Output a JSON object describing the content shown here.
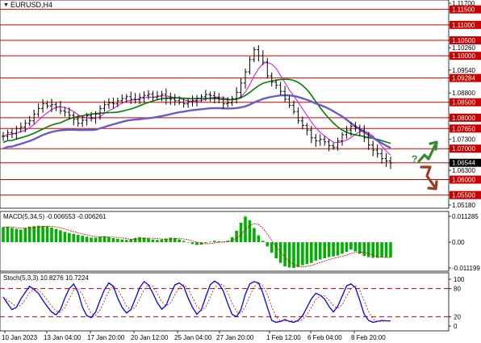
{
  "symbol_title": "EURUSD,H4",
  "colors": {
    "price_line": "#000000",
    "sma_short": "#e800e8",
    "sma_mid": "#008000",
    "sma_long": "#6a5acd",
    "level_line": "#cc0000",
    "macd_hist": "#00b000",
    "macd_signal": "#cc0000",
    "stoch_main": "#0000ff",
    "stoch_signal": "#cc0000",
    "arrow_up": "#2e8b2e",
    "arrow_down": "#a0391e"
  },
  "price_axis": {
    "labels": [
      "1.11700",
      "1.11500",
      "1.11000",
      "1.10500",
      "1.10260",
      "1.10000",
      "1.09540",
      "1.09284",
      "1.08800",
      "1.08500",
      "1.08000",
      "1.07650",
      "1.07300",
      "1.07000",
      "1.06544",
      "1.06300",
      "1.06000",
      "1.05500",
      "1.05180"
    ],
    "highlighted": [
      "1.11500",
      "1.11000",
      "1.10500",
      "1.10000",
      "1.09284",
      "1.08500",
      "1.08000",
      "1.07650",
      "1.07000",
      "1.06544",
      "1.06000",
      "1.05500"
    ],
    "current_price": "1.06544"
  },
  "levels": [
    1.115,
    1.11,
    1.105,
    1.1,
    1.09284,
    1.085,
    1.08,
    1.0765,
    1.07,
    1.06544,
    1.06,
    1.055
  ],
  "macd": {
    "label": "MACD(5,34,5) -0.006553 -0.006261",
    "axis_labels": [
      "0.011285",
      "0.00",
      "-0.011199"
    ]
  },
  "stoch": {
    "label": "Stoch(5,3,3) 10.8276 10.7224",
    "axis_labels": [
      "100",
      "80",
      "20",
      "0"
    ]
  },
  "time_axis": [
    "10 Jan 2023",
    "13 Jan 04:00",
    "17 Jan 20:00",
    "20 Jan 12:00",
    "25 Jan 04:00",
    "27 Jan 20:00",
    "1 Feb 12:00",
    "6 Feb 04:00",
    "8 Feb 20:00"
  ],
  "annotation": {
    "question_mark": "?"
  },
  "chart_data": {
    "type": "line",
    "title": "EURUSD,H4",
    "y_range": [
      1.0518,
      1.117
    ],
    "price_path": [
      1.074,
      1.0752,
      1.0748,
      1.0765,
      1.077,
      1.0782,
      1.079,
      1.0812,
      1.083,
      1.0845,
      1.0838,
      1.0842,
      1.0835,
      1.0822,
      1.0818,
      1.0808,
      1.0795,
      1.0782,
      1.0792,
      1.0806,
      1.08,
      1.0812,
      1.083,
      1.0842,
      1.0848,
      1.0845,
      1.0855,
      1.0862,
      1.0868,
      1.086,
      1.0858,
      1.0866,
      1.0872,
      1.0876,
      1.0866,
      1.087,
      1.0876,
      1.0862,
      1.086,
      1.0855,
      1.085,
      1.0845,
      1.0853,
      1.0856,
      1.0862,
      1.0868,
      1.0875,
      1.0872,
      1.0865,
      1.086,
      1.0845,
      1.0848,
      1.0862,
      1.0882,
      1.0912,
      1.0948,
      1.0988,
      1.102,
      1.1,
      1.098,
      1.0935,
      1.0915,
      1.0905,
      1.0885,
      1.086,
      1.084,
      1.082,
      1.079,
      1.0775,
      1.076,
      1.0735,
      1.0725,
      1.073,
      1.0722,
      1.071,
      1.0705,
      1.0725,
      1.0745,
      1.076,
      1.0772,
      1.0768,
      1.076,
      1.0735,
      1.0712,
      1.0695,
      1.0684,
      1.0668,
      1.066,
      1.0654
    ],
    "macd_hist": [
      0.0065,
      0.0068,
      0.0062,
      0.0058,
      0.0055,
      0.0062,
      0.0068,
      0.007,
      0.0072,
      0.0071,
      0.0069,
      0.0064,
      0.0058,
      0.0052,
      0.0045,
      0.004,
      0.0036,
      0.0032,
      0.0028,
      0.0024,
      0.002,
      0.002,
      0.0024,
      0.0026,
      0.0022,
      0.0018,
      0.0015,
      0.0012,
      0.001,
      0.0013,
      0.0018,
      0.0022,
      0.002,
      0.0016,
      0.0012,
      0.001,
      0.0012,
      0.0016,
      0.002,
      0.0018,
      0.0012,
      0.0006,
      0.0,
      -0.0008,
      -0.0012,
      -0.001,
      -0.0004,
      0.0002,
      0.0006,
      0.0004,
      0.0,
      0.0006,
      0.0022,
      0.005,
      0.0085,
      0.0112,
      0.0095,
      0.0062,
      0.003,
      0.0006,
      -0.0018,
      -0.0045,
      -0.007,
      -0.009,
      -0.0105,
      -0.011,
      -0.0112,
      -0.0108,
      -0.01,
      -0.0095,
      -0.009,
      -0.008,
      -0.0075,
      -0.007,
      -0.0065,
      -0.0062,
      -0.0058,
      -0.005,
      -0.0042,
      -0.0032,
      -0.004,
      -0.005,
      -0.006,
      -0.0065,
      -0.0068,
      -0.0068,
      -0.0066,
      -0.0066,
      -0.0066
    ],
    "stoch_main": [
      62,
      48,
      35,
      40,
      58,
      72,
      85,
      78,
      70,
      55,
      42,
      30,
      24,
      35,
      60,
      80,
      90,
      72,
      40,
      22,
      18,
      30,
      55,
      78,
      92,
      85,
      60,
      40,
      28,
      35,
      58,
      82,
      95,
      88,
      70,
      50,
      36,
      44,
      68,
      88,
      92,
      85,
      60,
      40,
      25,
      35,
      62,
      88,
      96,
      90,
      75,
      48,
      25,
      20,
      35,
      68,
      90,
      95,
      92,
      70,
      40,
      12,
      8,
      10,
      14,
      10,
      8,
      12,
      22,
      40,
      58,
      70,
      66,
      58,
      42,
      30,
      42,
      64,
      86,
      90,
      82,
      55,
      25,
      12,
      8,
      10,
      12,
      11,
      11
    ]
  }
}
